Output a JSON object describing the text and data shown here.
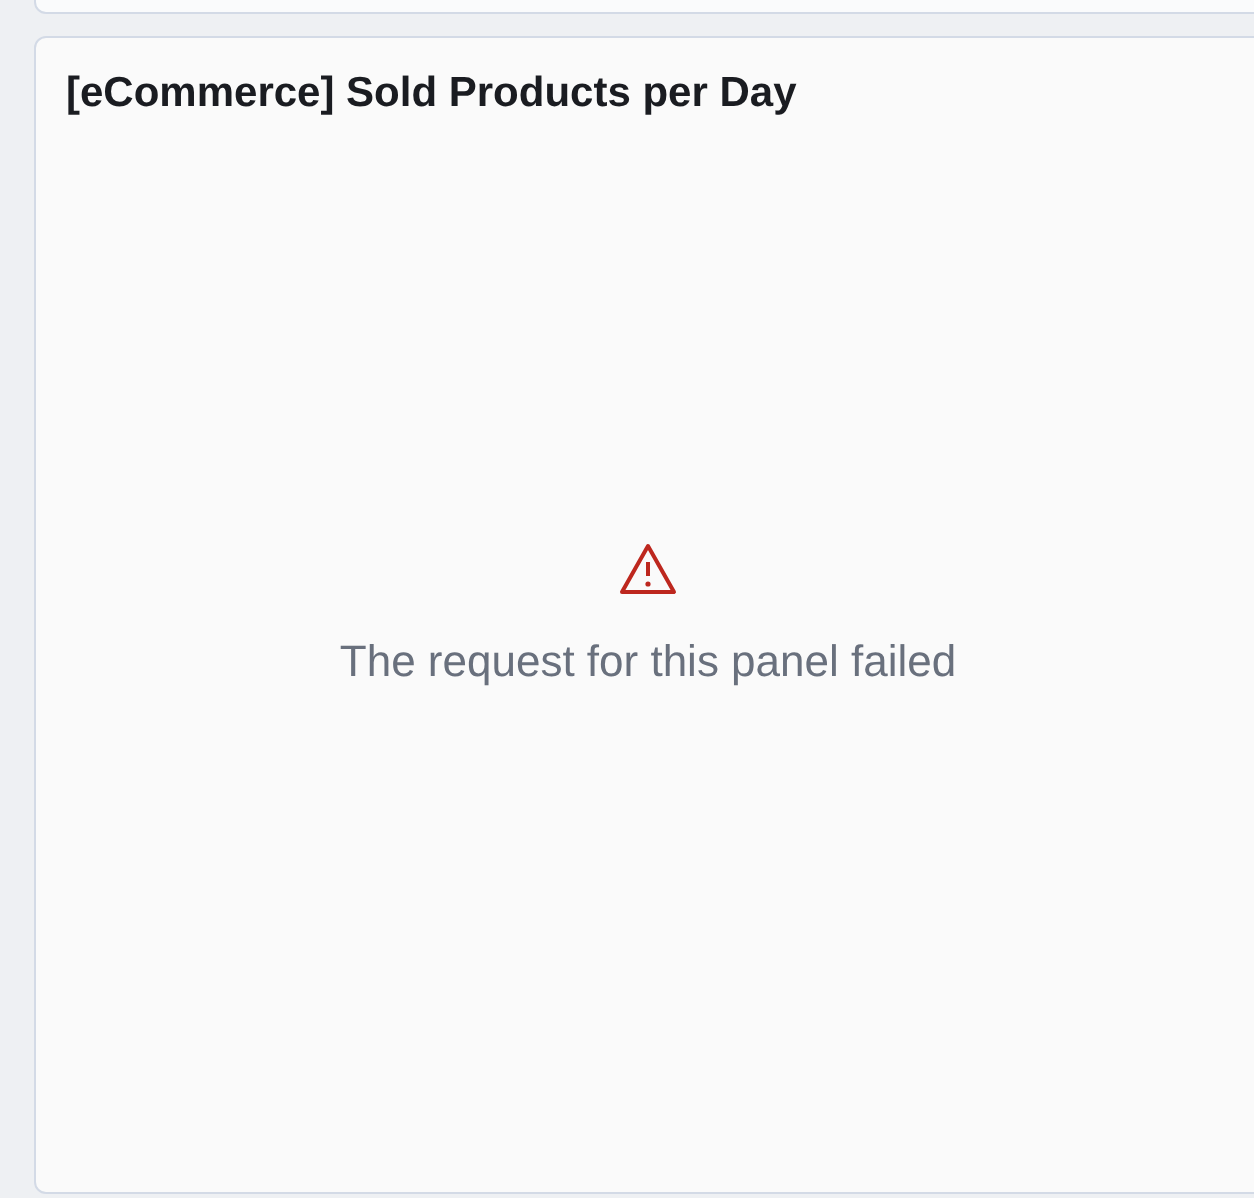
{
  "panel": {
    "title": "[eCommerce] Sold Products per Day",
    "error": {
      "message": "The request for this panel failed"
    }
  }
}
